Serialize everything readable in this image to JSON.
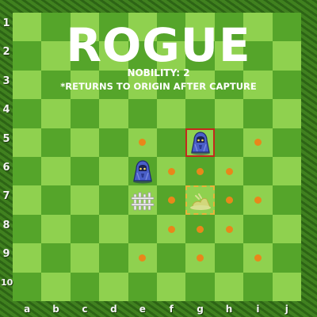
{
  "title": "ROGUE",
  "nobility_text": "NOBILITY:   2",
  "note": "*RETURNS TO ORIGIN AFTER CAPTURE",
  "ranks": [
    "1",
    "2",
    "3",
    "4",
    "5",
    "6",
    "7",
    "8",
    "9",
    "10"
  ],
  "files": [
    "a",
    "b",
    "c",
    "d",
    "e",
    "f",
    "g",
    "h",
    "i",
    "j"
  ],
  "colors": {
    "light_square": "#8fd14f",
    "dark_square": "#55a52a",
    "frame": "#3a7a1c",
    "move_dot": "#e8871a",
    "selected_border": "#c4281c",
    "origin_border": "#e8b33a",
    "piece_blue": "#4a5fc8"
  },
  "pieces": [
    {
      "type": "rogue",
      "square": "g5",
      "icon": "hooded-figure-icon",
      "selected": true
    },
    {
      "type": "rogue",
      "square": "e6",
      "icon": "hooded-figure-icon",
      "selected": false
    },
    {
      "type": "obstacle",
      "square": "e7",
      "icon": "fence-icon"
    },
    {
      "type": "origin",
      "square": "g7",
      "icon": "ghost-trail-icon"
    }
  ],
  "move_targets": [
    "e5",
    "i5",
    "f6",
    "g6",
    "h6",
    "f7",
    "h7",
    "i7",
    "f8",
    "g8",
    "h8",
    "e9",
    "g9",
    "i9"
  ]
}
